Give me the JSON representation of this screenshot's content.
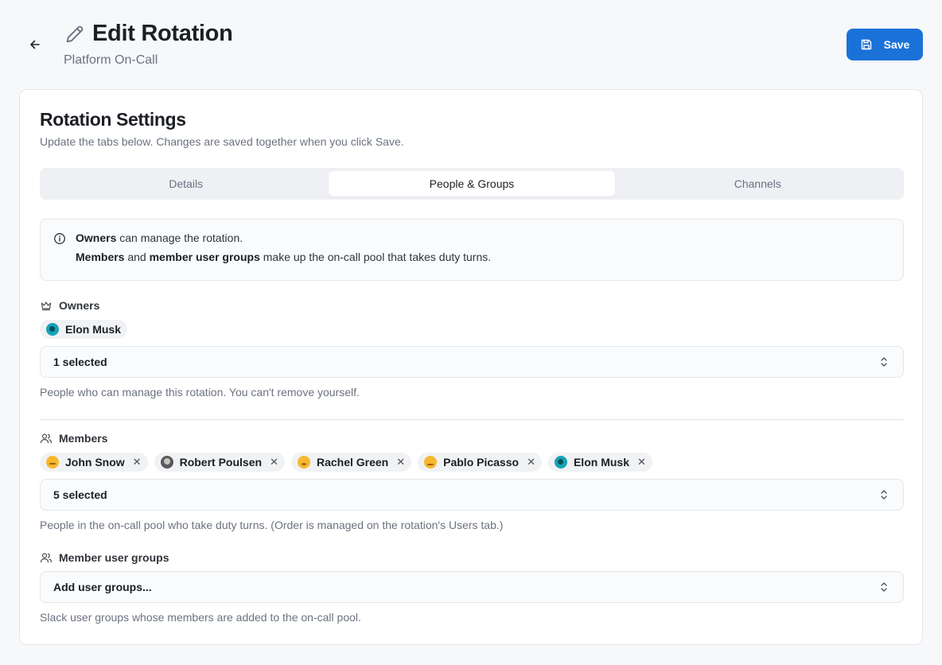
{
  "header": {
    "title": "Edit Rotation",
    "subtitle": "Platform On-Call",
    "save_label": "Save"
  },
  "card": {
    "title": "Rotation Settings",
    "description": "Update the tabs below. Changes are saved together when you click Save.",
    "tabs": [
      {
        "label": "Details",
        "active": false
      },
      {
        "label": "People & Groups",
        "active": true
      },
      {
        "label": "Channels",
        "active": false
      }
    ]
  },
  "info": {
    "line1_strong": "Owners",
    "line1_rest": " can manage the rotation.",
    "line2_strong1": "Members",
    "line2_mid": " and ",
    "line2_strong2": "member user groups",
    "line2_rest": " make up the on-call pool that takes duty turns."
  },
  "owners": {
    "label": "Owners",
    "chips": [
      {
        "name": "Elon Musk",
        "avatar": "teal-avatar"
      }
    ],
    "select_value": "1 selected",
    "help": "People who can manage this rotation. You can't remove yourself."
  },
  "members": {
    "label": "Members",
    "chips": [
      {
        "name": "John Snow",
        "avatar": "yellow-avatar"
      },
      {
        "name": "Robert Poulsen",
        "avatar": "photo-avatar"
      },
      {
        "name": "Rachel Green",
        "avatar": "yellow-avatar"
      },
      {
        "name": "Pablo Picasso",
        "avatar": "yellow-avatar"
      },
      {
        "name": "Elon Musk",
        "avatar": "teal-avatar"
      }
    ],
    "select_value": "5 selected",
    "help": "People in the on-call pool who take duty turns. (Order is managed on the rotation's Users tab.)"
  },
  "groups": {
    "label": "Member user groups",
    "select_value": "Add user groups...",
    "help": "Slack user groups whose members are added to the on-call pool."
  },
  "colors": {
    "accent": "#1a72d9",
    "background": "#f7f8fa",
    "avatar_teal": "#17a2b8",
    "avatar_yellow": "#f5b82e"
  }
}
